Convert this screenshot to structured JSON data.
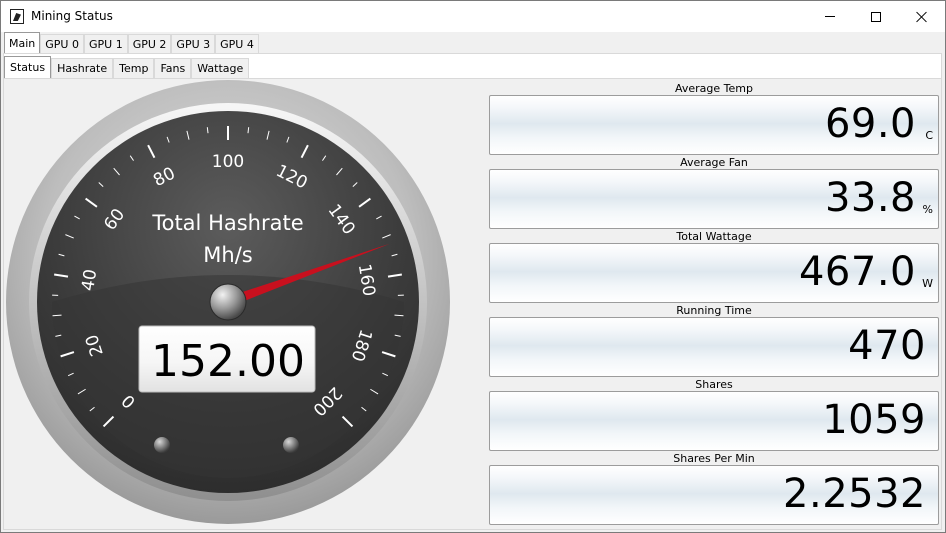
{
  "window": {
    "title": "Mining Status"
  },
  "device_tabs": [
    "Main",
    "GPU 0",
    "GPU 1",
    "GPU 2",
    "GPU 3",
    "GPU 4"
  ],
  "view_tabs": [
    "Status",
    "Hashrate",
    "Temp",
    "Fans",
    "Wattage"
  ],
  "gauge": {
    "title_line1": "Total Hashrate",
    "title_line2": "Mh/s",
    "value": 152.0,
    "display": "152.00",
    "scale_labels": [
      "0",
      "20",
      "40",
      "60",
      "80",
      "100",
      "120",
      "140",
      "160",
      "180",
      "200"
    ]
  },
  "stats": [
    {
      "label": "Average Temp",
      "value": "69.0",
      "unit": "C"
    },
    {
      "label": "Average Fan",
      "value": "33.8",
      "unit": "%"
    },
    {
      "label": "Total Wattage",
      "value": "467.0",
      "unit": "W"
    },
    {
      "label": "Running Time",
      "value": "470",
      "unit": ""
    },
    {
      "label": "Shares",
      "value": "1059",
      "unit": ""
    },
    {
      "label": "Shares Per Min",
      "value": "2.2532",
      "unit": ""
    }
  ],
  "colors": {
    "needle": "#c8101e",
    "dial_face": "#3a3a3a",
    "bezel": "#b4b4b4"
  }
}
